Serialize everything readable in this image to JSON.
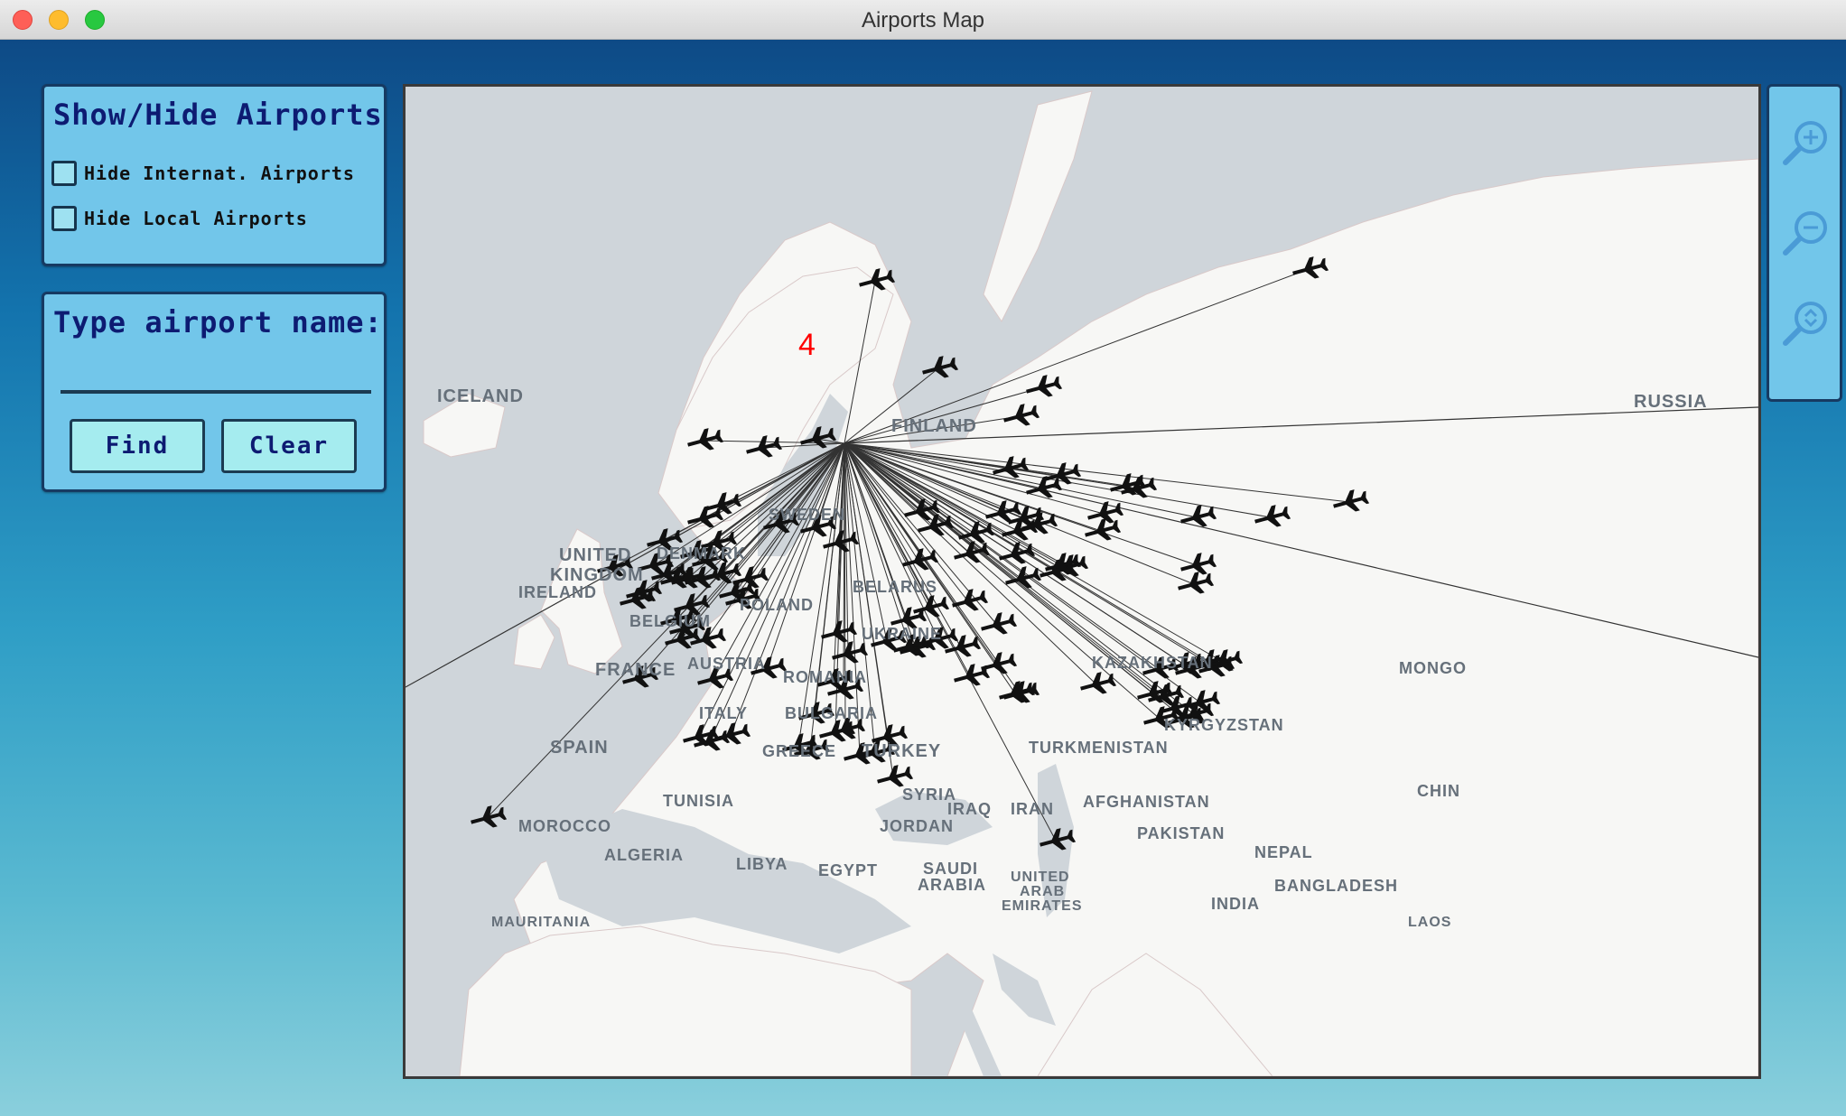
{
  "window": {
    "title": "Airports Map"
  },
  "show_hide": {
    "title": "Show/Hide Airports",
    "hide_international_label": "Hide Internat. Airports",
    "hide_local_label": "Hide Local Airports"
  },
  "search": {
    "title": "Type airport name:",
    "value": "",
    "find_label": "Find",
    "clear_label": "Clear"
  },
  "zoom": {
    "icons": [
      "zoom-in-icon",
      "zoom-out-icon",
      "zoom-reset-icon"
    ]
  },
  "map": {
    "cluster_count": "4",
    "labels": {
      "iceland": "ICELAND",
      "finland": "FINLAND",
      "russia": "RUSSIA",
      "sweden": "SWEDEN",
      "united": "UNITED",
      "kingdom": "KINGDOM",
      "ireland": "IRELAND",
      "denmark": "DENMARK",
      "belarus": "BELARUS",
      "poland": "POLAND",
      "belgium": "BELGIUM",
      "ukraine": "UKRAINE",
      "france": "FRANCE",
      "austria": "AUSTRIA",
      "romania": "ROMANIA",
      "kazakhstan": "KAZAKHSTAN",
      "mongolia": "MONGO",
      "kyrgyzstan": "KYRGYZSTAN",
      "spain": "SPAIN",
      "italy": "ITALY",
      "bulgaria": "BULGARIA",
      "greece": "GREECE",
      "turkey": "TURKEY",
      "turkmenistan": "TURKMENISTAN",
      "china": "CHIN",
      "tunisia": "TUNISIA",
      "syria": "SYRIA",
      "iraq": "IRAQ",
      "iran": "IRAN",
      "afghanistan": "AFGHANISTAN",
      "morocco": "MOROCCO",
      "jordan": "JORDAN",
      "pakistan": "PAKISTAN",
      "nepal": "NEPAL",
      "algeria": "ALGERIA",
      "libya": "LIBYA",
      "egypt": "EGYPT",
      "saudi": "SAUDI",
      "arabia": "ARABIA",
      "uae_1": "UNITED",
      "uae_2": "ARAB",
      "uae_3": "EMIRATES",
      "bangladesh": "BANGLADESH",
      "india": "INDIA",
      "mauritania": "MAURITANIA",
      "laos": "LAOS"
    },
    "colors": {
      "sea": "#cfd5da",
      "land": "#f7f7f5",
      "route": "#333333",
      "count": "#ff0000"
    }
  }
}
